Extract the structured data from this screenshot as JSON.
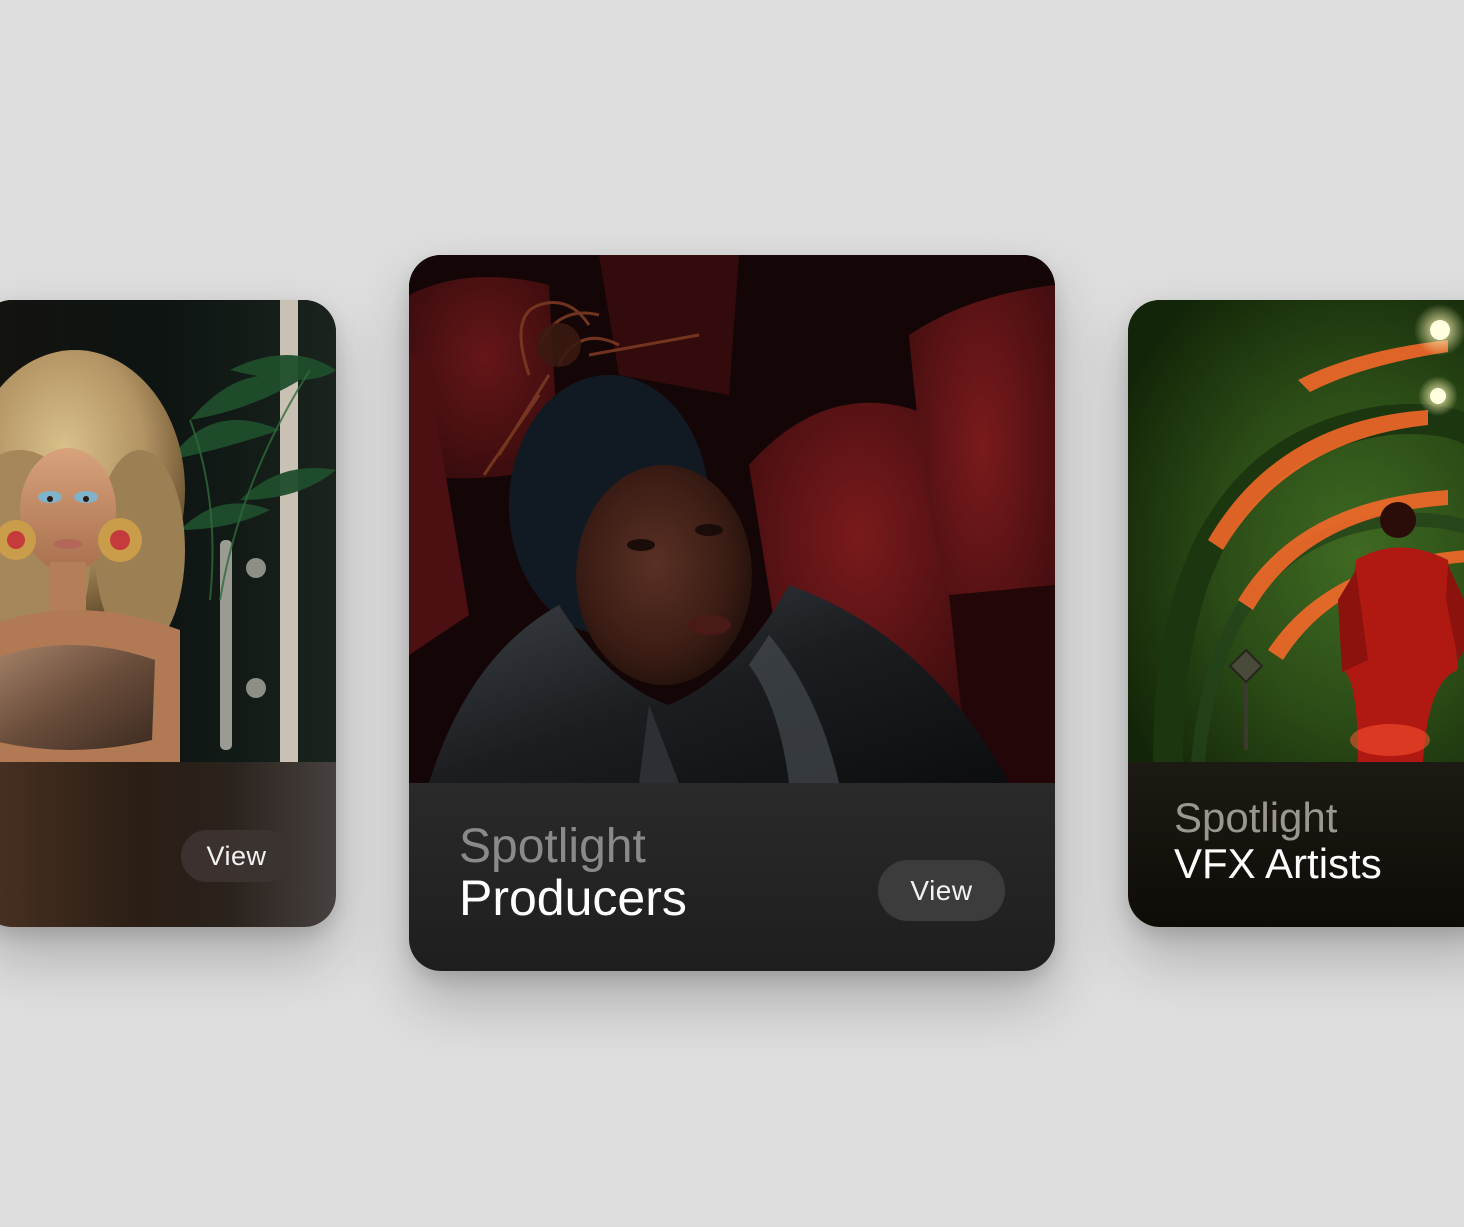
{
  "carousel": {
    "cards": [
      {
        "position": "left",
        "image": "woman-with-blonde-voluminous-hair-and-blue-eyeshadow",
        "view_label": "View"
      },
      {
        "position": "center",
        "image": "woman-in-red-theater-seats-leather-jacket",
        "title_top": "Spotlight",
        "title_bottom": "Producers",
        "view_label": "View"
      },
      {
        "position": "right",
        "image": "man-in-red-suit-in-green-tunnel-with-orange-lights",
        "title_top": "Spotlight",
        "title_bottom": "VFX Artists"
      }
    ]
  },
  "colors": {
    "page_background": "#dedede",
    "panel_dark": "#1e1e1e",
    "button_background": "#3c3c3c",
    "label_muted": "#8a8a8a",
    "label_bright": "#ffffff"
  }
}
